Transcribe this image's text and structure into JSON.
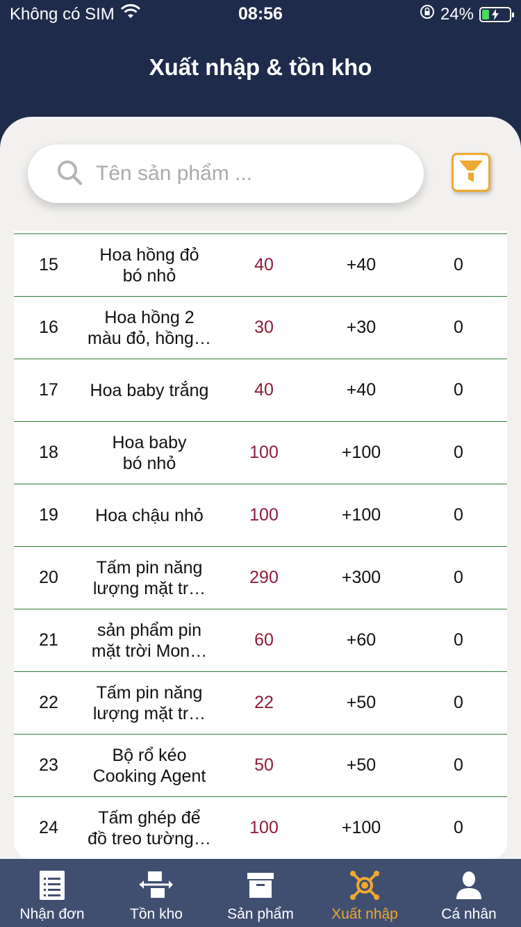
{
  "status": {
    "carrier": "Không có SIM",
    "time": "08:56",
    "battery": "24%"
  },
  "header": {
    "title": "Xuất nhập & tồn kho"
  },
  "search": {
    "placeholder": "Tên sản phẩm ..."
  },
  "rows": [
    {
      "no": "15",
      "name1": "Hoa hồng đỏ",
      "name2": "bó nhỏ",
      "stock": "40",
      "in": "+40",
      "out": "0"
    },
    {
      "no": "16",
      "name1": "Hoa hồng 2",
      "name2": "màu đỏ, hồng…",
      "stock": "30",
      "in": "+30",
      "out": "0"
    },
    {
      "no": "17",
      "name1": "Hoa baby trắng",
      "name2": "",
      "stock": "40",
      "in": "+40",
      "out": "0"
    },
    {
      "no": "18",
      "name1": "Hoa baby",
      "name2": "bó nhỏ",
      "stock": "100",
      "in": "+100",
      "out": "0"
    },
    {
      "no": "19",
      "name1": "Hoa chậu nhỏ",
      "name2": "",
      "stock": "100",
      "in": "+100",
      "out": "0"
    },
    {
      "no": "20",
      "name1": "Tấm pin năng",
      "name2": "lượng mặt tr…",
      "stock": "290",
      "in": "+300",
      "out": "0"
    },
    {
      "no": "21",
      "name1": "sản phẩm pin",
      "name2": "mặt trời Mon…",
      "stock": "60",
      "in": "+60",
      "out": "0"
    },
    {
      "no": "22",
      "name1": "Tấm pin năng",
      "name2": "lượng mặt tr…",
      "stock": "22",
      "in": "+50",
      "out": "0"
    },
    {
      "no": "23",
      "name1": "Bộ rổ kéo",
      "name2": "Cooking Agent",
      "stock": "50",
      "in": "+50",
      "out": "0"
    },
    {
      "no": "24",
      "name1": "Tấm ghép để",
      "name2": "đồ treo tường…",
      "stock": "100",
      "in": "+100",
      "out": "0"
    }
  ],
  "tabs": [
    {
      "label": "Nhận đơn",
      "icon": "order-list-icon"
    },
    {
      "label": "Tồn kho",
      "icon": "inventory-transfer-icon"
    },
    {
      "label": "Sản phẩm",
      "icon": "product-box-icon"
    },
    {
      "label": "Xuất nhập",
      "icon": "import-export-icon",
      "active": true
    },
    {
      "label": "Cá nhân",
      "icon": "user-icon"
    }
  ],
  "colors": {
    "header_bg": "#1f2b4a",
    "accent": "#f0a830",
    "stock_text": "#8e1b3a",
    "row_divider": "#2e7d32",
    "tabbar_bg": "#404f70"
  }
}
